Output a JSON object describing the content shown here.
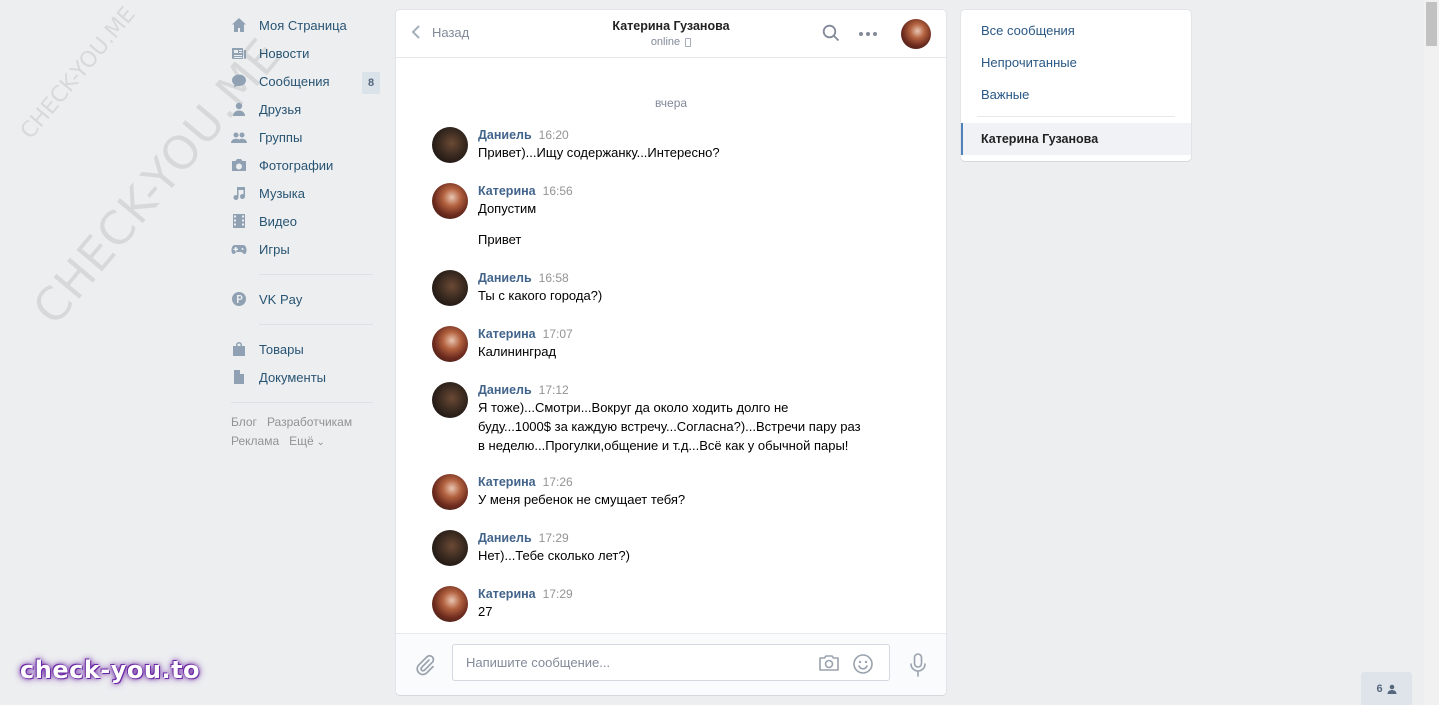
{
  "watermark": {
    "small": "CHECK-YOU.ME",
    "big": "CHECK-YOU.ME"
  },
  "brand": "check-you.to",
  "sidebar": {
    "items": [
      {
        "label": "Моя Страница",
        "icon": "home-icon"
      },
      {
        "label": "Новости",
        "icon": "news-icon"
      },
      {
        "label": "Сообщения",
        "icon": "messages-icon",
        "count": "8"
      },
      {
        "label": "Друзья",
        "icon": "friends-icon"
      },
      {
        "label": "Группы",
        "icon": "groups-icon"
      },
      {
        "label": "Фотографии",
        "icon": "camera-icon"
      },
      {
        "label": "Музыка",
        "icon": "music-icon"
      },
      {
        "label": "Видео",
        "icon": "video-icon"
      },
      {
        "label": "Игры",
        "icon": "gamepad-icon"
      }
    ],
    "vkpay": {
      "label": "VK Pay",
      "icon": "vkpay-icon"
    },
    "extra": [
      {
        "label": "Товары",
        "icon": "bag-icon"
      },
      {
        "label": "Документы",
        "icon": "document-icon"
      }
    ],
    "footer": {
      "blog": "Блог",
      "developers": "Разработчикам",
      "ads": "Реклама",
      "more": "Ещё"
    }
  },
  "chat": {
    "back_label": "Назад",
    "peer_name": "Катерина Гузанова",
    "peer_status": "online",
    "day_separator": "вчера",
    "messages": [
      {
        "author": "Даниель",
        "time": "16:20",
        "lines": [
          "Привет)...Ищу содержанку...Интересно?"
        ]
      },
      {
        "author": "Катерина",
        "time": "16:56",
        "lines": [
          "Допустим"
        ],
        "extra": "Привет"
      },
      {
        "author": "Даниель",
        "time": "16:58",
        "lines": [
          "Ты с какого города?)"
        ]
      },
      {
        "author": "Катерина",
        "time": "17:07",
        "lines": [
          "Калининград"
        ]
      },
      {
        "author": "Даниель",
        "time": "17:12",
        "lines": [
          "Я тоже)...Смотри...Вокруг да около ходить долго не",
          "буду...1000$ за каждую встречу...Согласна?)...Встречи пару раз",
          "в неделю...Прогулки,общение и т.д...Всё как у обычной пары!"
        ]
      },
      {
        "author": "Катерина",
        "time": "17:26",
        "lines": [
          "У меня ребенок не смущает тебя?"
        ]
      },
      {
        "author": "Даниель",
        "time": "17:29",
        "lines": [
          "Нет)...Тебе сколько лет?)"
        ]
      },
      {
        "author": "Катерина",
        "time": "17:29",
        "lines": [
          "27"
        ]
      }
    ],
    "composer_placeholder": "Напишите сообщение..."
  },
  "filters": {
    "all": "Все сообщения",
    "unread": "Непрочитанные",
    "important": "Важные",
    "active": "Катерина Гузанова"
  },
  "widget": {
    "count": "6"
  }
}
